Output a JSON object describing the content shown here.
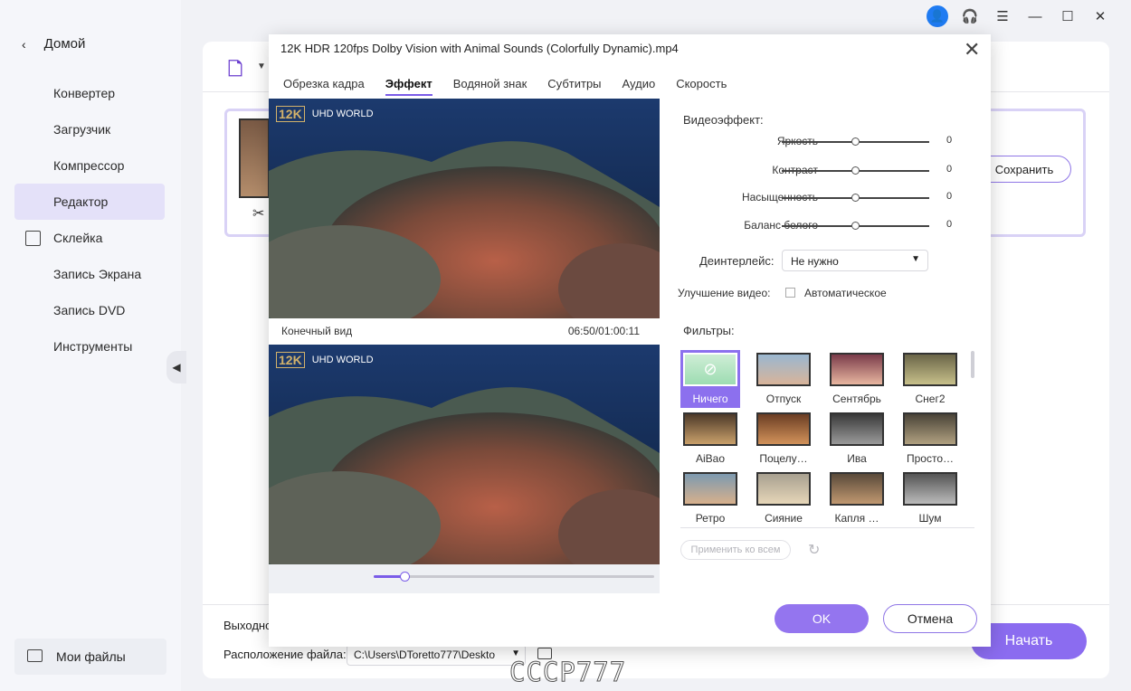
{
  "sidebar": {
    "home_label": "Домой",
    "items": [
      {
        "label": "Конвертер",
        "active": false
      },
      {
        "label": "Загрузчик",
        "active": false
      },
      {
        "label": "Компрессор",
        "active": false
      },
      {
        "label": "Редактор",
        "active": true
      },
      {
        "label": "Склейка",
        "active": false
      },
      {
        "label": "Запись Экрана",
        "active": false
      },
      {
        "label": "Запись DVD",
        "active": false
      },
      {
        "label": "Инструменты",
        "active": false
      }
    ],
    "my_files_label": "Мои файлы"
  },
  "main": {
    "save_label": "Сохранить",
    "output_label": "Выходно",
    "location_label": "Расположение файла:",
    "path_value": "C:\\Users\\DToretto777\\Deskto",
    "start_label": "Начать"
  },
  "dialog": {
    "title": "12K HDR 120fps Dolby Vision with Animal Sounds (Colorfully Dynamic).mp4",
    "tabs": [
      {
        "label": "Обрезка кадра",
        "active": false
      },
      {
        "label": "Эффект",
        "active": true
      },
      {
        "label": "Водяной знак",
        "active": false
      },
      {
        "label": "Субтитры",
        "active": false
      },
      {
        "label": "Аудио",
        "active": false
      },
      {
        "label": "Скорость",
        "active": false
      }
    ],
    "video_logo_badge": "12K",
    "video_logo_text": "UHD WORLD",
    "final_view_label": "Конечный вид",
    "time": "06:50/01:00:11",
    "playback_progress": 0.11,
    "video_effect_label": "Видеоэффект:",
    "sliders": [
      {
        "label": "Яркость",
        "value": "0",
        "position": 0.5
      },
      {
        "label": "Контраст",
        "value": "0",
        "position": 0.5
      },
      {
        "label": "Насыщенность",
        "value": "0",
        "position": 0.5
      },
      {
        "label": "Баланс белого",
        "value": "0",
        "position": 0.5
      }
    ],
    "deinterlace_label": "Деинтерлейс:",
    "deinterlace_value": "Не нужно",
    "enhance_label": "Улучшение видео:",
    "enhance_auto_label": "Автоматическое",
    "filters_label": "Фильтры:",
    "filters": [
      {
        "label": "Ничего",
        "selected": true
      },
      {
        "label": "Отпуск",
        "selected": false
      },
      {
        "label": "Сентябрь",
        "selected": false
      },
      {
        "label": "Снег2",
        "selected": false
      },
      {
        "label": "AiBao",
        "selected": false
      },
      {
        "label": "Поцелу…",
        "selected": false
      },
      {
        "label": "Ива",
        "selected": false
      },
      {
        "label": "Просто…",
        "selected": false
      },
      {
        "label": "Ретро",
        "selected": false
      },
      {
        "label": "Сияние",
        "selected": false
      },
      {
        "label": "Капля …",
        "selected": false
      },
      {
        "label": "Шум",
        "selected": false
      }
    ],
    "apply_all_label": "Применить ко всем",
    "ok_label": "OK",
    "cancel_label": "Отмена"
  },
  "watermark_text": "СССР777",
  "colors": {
    "accent": "#8b6cf0",
    "user_icon": "#1f7bf2"
  }
}
